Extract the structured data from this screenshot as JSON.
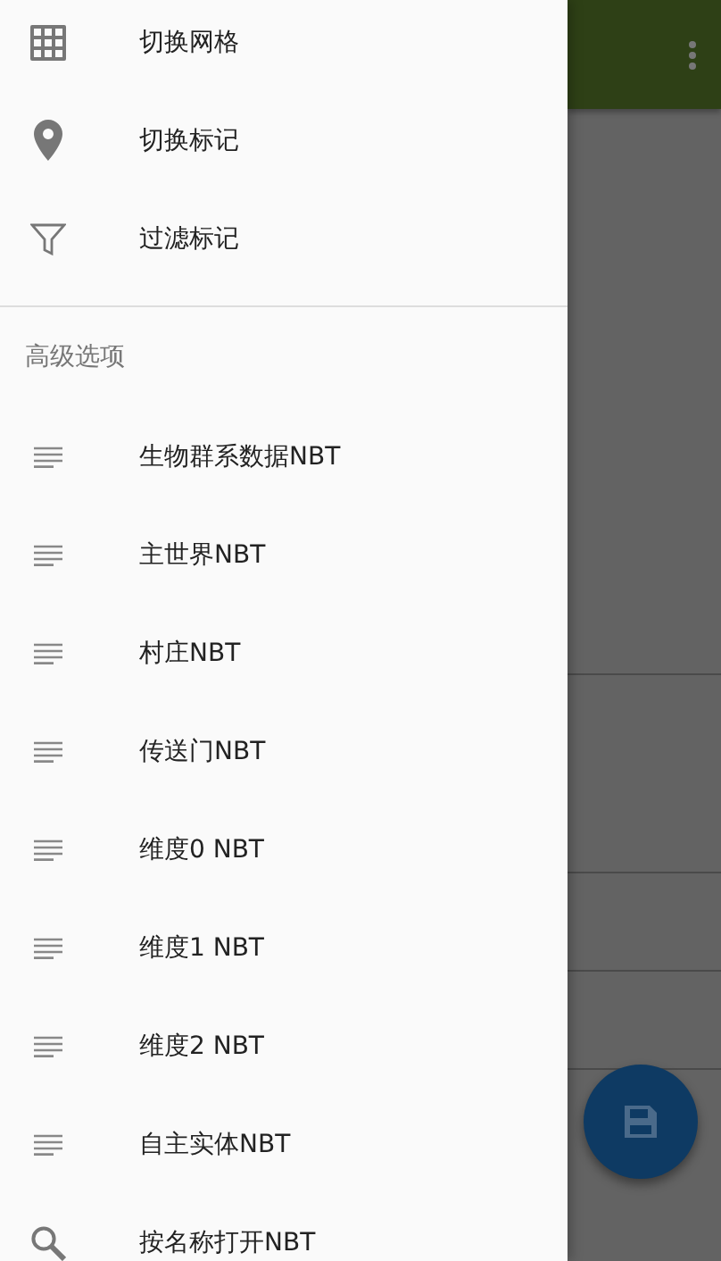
{
  "drawer": {
    "top_items": [
      {
        "kind": "grid",
        "label": "切换网格"
      },
      {
        "kind": "pin",
        "label": "切换标记"
      },
      {
        "kind": "filter",
        "label": "过滤标记"
      }
    ],
    "section_header": "高级选项",
    "advanced_items": [
      {
        "kind": "lines",
        "label": "生物群系数据NBT"
      },
      {
        "kind": "lines",
        "label": "主世界NBT"
      },
      {
        "kind": "lines",
        "label": "村庄NBT"
      },
      {
        "kind": "lines",
        "label": "传送门NBT"
      },
      {
        "kind": "lines",
        "label": "维度0 NBT"
      },
      {
        "kind": "lines",
        "label": "维度1 NBT"
      },
      {
        "kind": "lines",
        "label": "维度2 NBT"
      },
      {
        "kind": "lines",
        "label": "自主实体NBT"
      },
      {
        "kind": "search",
        "label": "按名称打开NBT"
      }
    ]
  }
}
